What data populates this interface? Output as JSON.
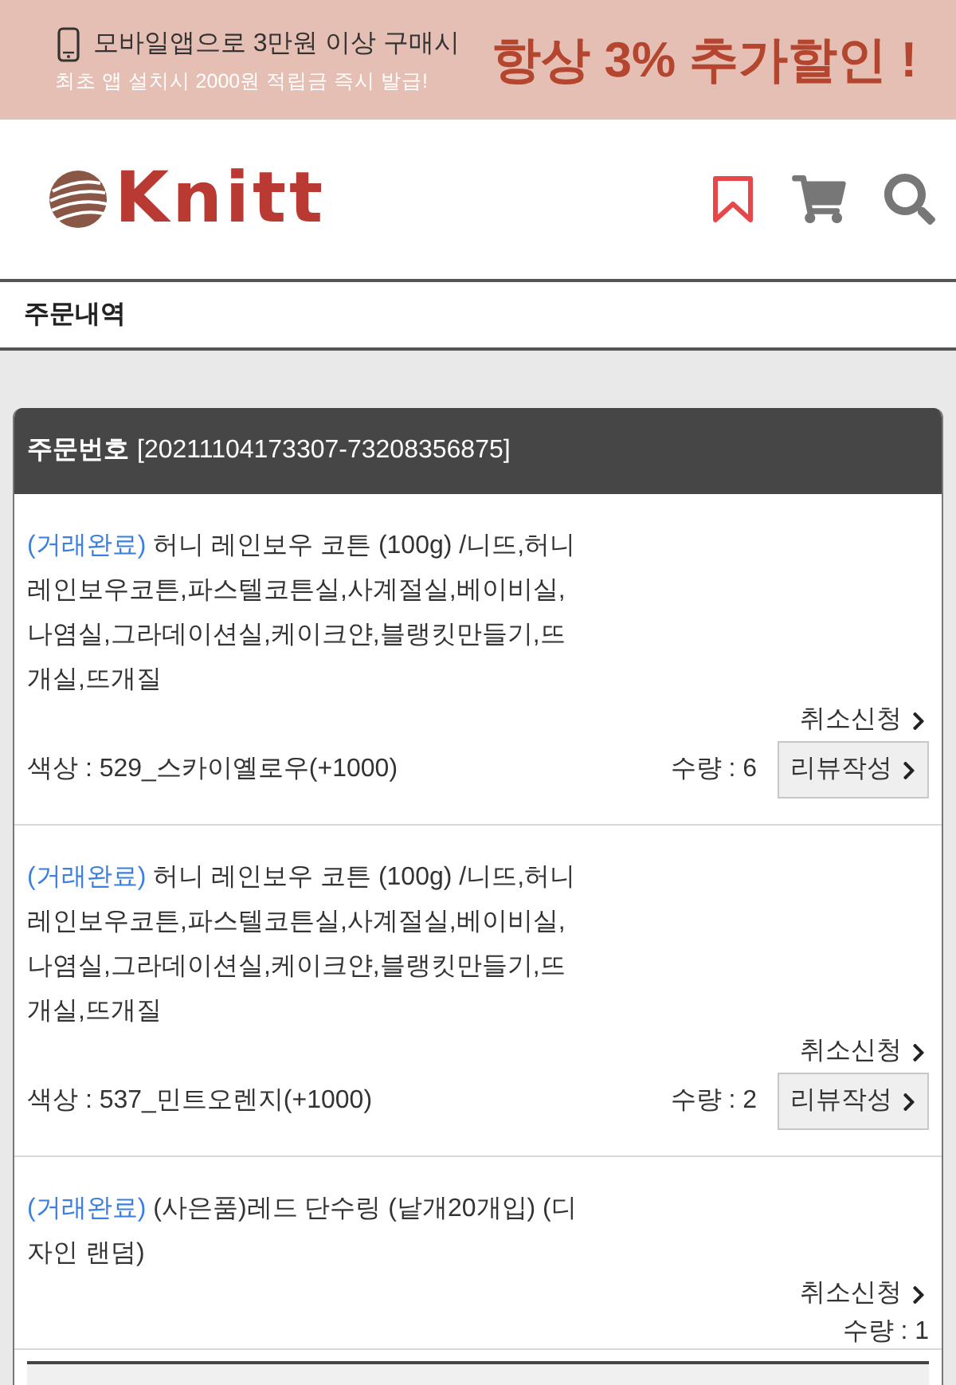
{
  "banner": {
    "line_1": "모바일앱으로 3만원 이상 구매시",
    "line_2": "최초 앱 설치시 2000원 적립금 즉시 발급!",
    "headline": "항상 3% 추가할인 !"
  },
  "header": {
    "logo_text": "Knitt"
  },
  "page_title": "주문내역",
  "order": {
    "label": "주문번호",
    "number": "[20211104173307-73208356875]",
    "items": [
      {
        "status": "(거래완료)",
        "name": "허니 레인보우 코튼 (100g) /니뜨,허니레인보우코튼,파스텔코튼실,사계절실,베이비실,나염실,그라데이션실,케이크얀,블랭킷만들기,뜨개실,뜨개질",
        "cancel": "취소신청",
        "option": "색상 : 529_스카이옐로우(+1000)",
        "quantity": "수량 : 6",
        "review": "리뷰작성"
      },
      {
        "status": "(거래완료)",
        "name": "허니 레인보우 코튼 (100g) /니뜨,허니레인보우코튼,파스텔코튼실,사계절실,베이비실,나염실,그라데이션실,케이크얀,블랭킷만들기,뜨개실,뜨개질",
        "cancel": "취소신청",
        "option": "색상 : 537_민트오렌지(+1000)",
        "quantity": "수량 : 2",
        "review": "리뷰작성"
      },
      {
        "status": "(거래완료)",
        "name": "(사은품)레드 단수링 (낱개20개입) (디자인 랜덤)",
        "cancel": "취소신청",
        "quantity": "수량 : 1"
      }
    ]
  }
}
